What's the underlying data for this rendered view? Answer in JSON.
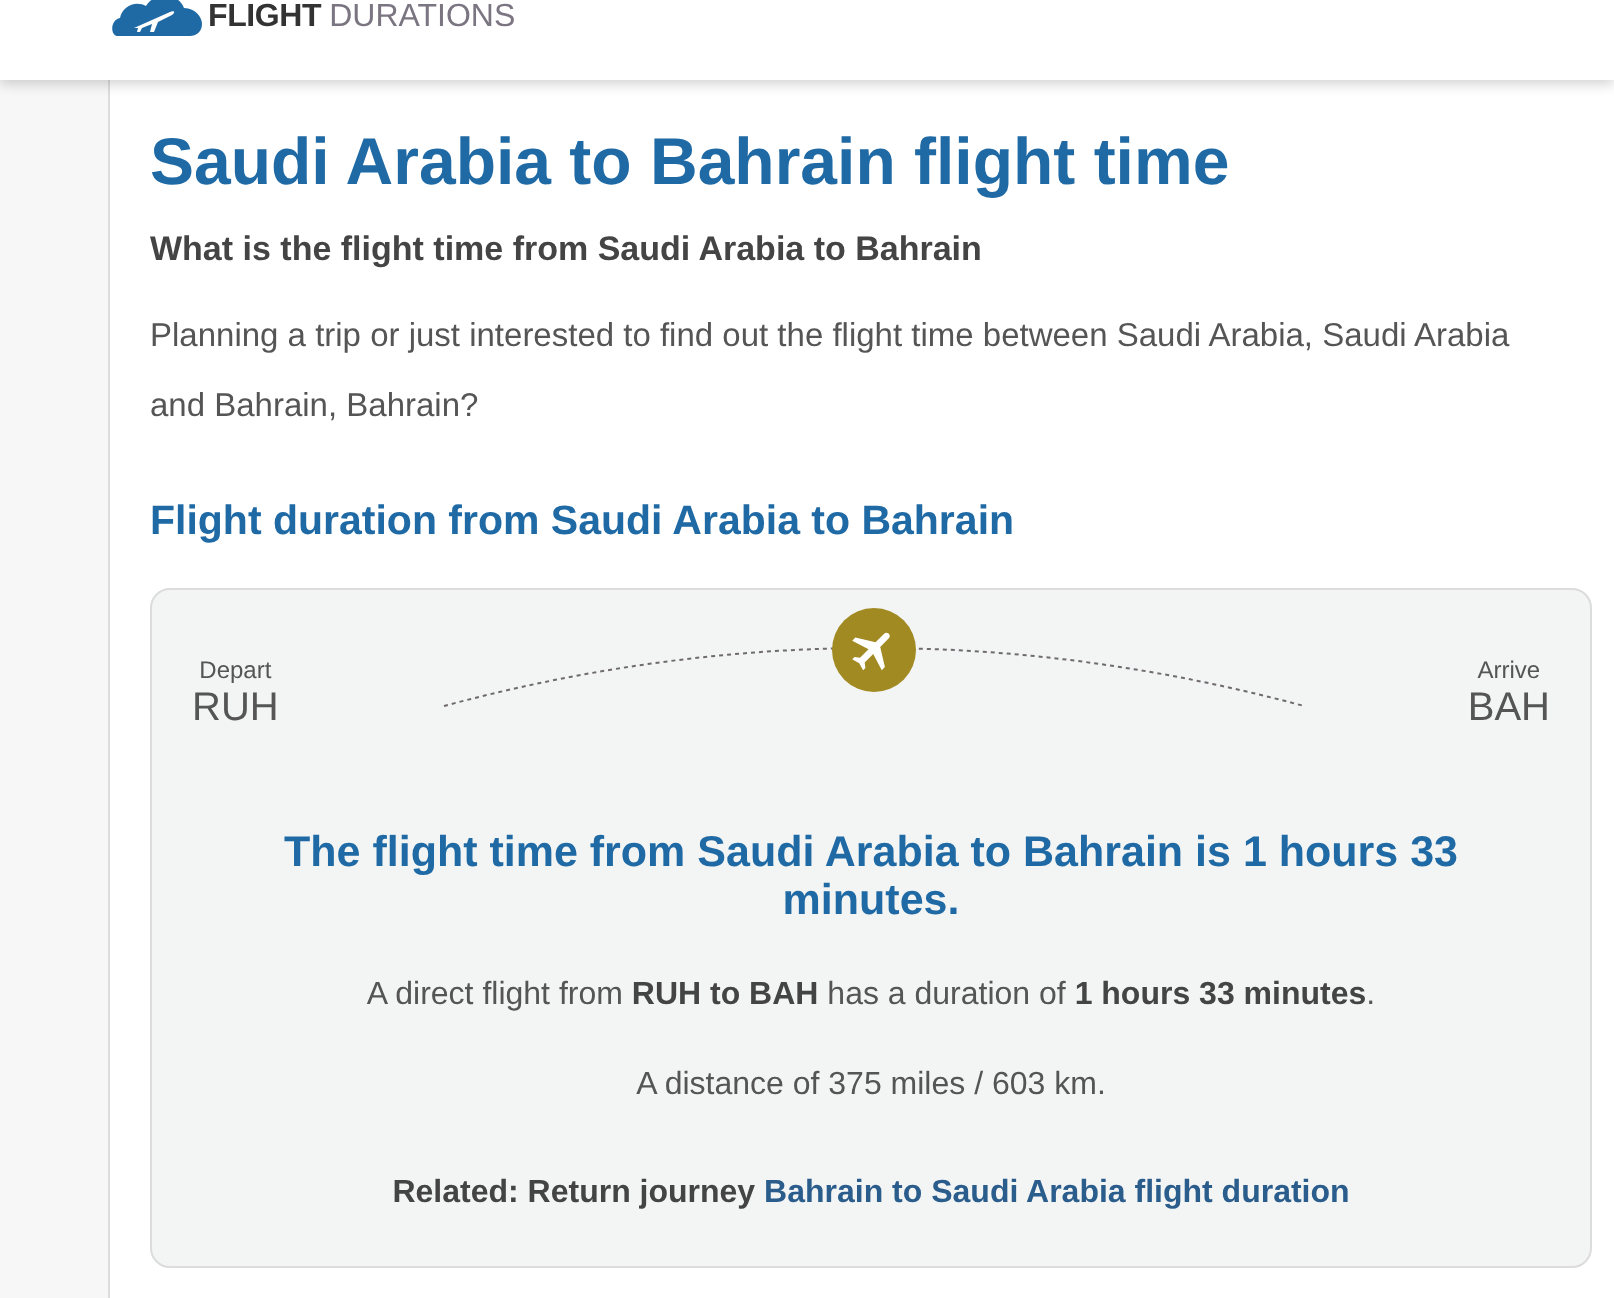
{
  "header": {
    "logo": {
      "bold": "FLIGHT",
      "light": "DURATIONS"
    }
  },
  "article": {
    "title": "Saudi Arabia to Bahrain flight time",
    "subtitle": "What is the flight time from Saudi Arabia to Bahrain",
    "intro": "Planning a trip or just interested to find out the flight time between Saudi Arabia, Saudi Arabia and Bahrain, Bahrain?",
    "section_heading": "Flight duration from Saudi Arabia to Bahrain"
  },
  "route_card": {
    "depart": {
      "label": "Depart",
      "code": "RUH"
    },
    "arrive": {
      "label": "Arrive",
      "code": "BAH"
    },
    "headline": "The flight time from Saudi Arabia to Bahrain is 1 hours 33 minutes.",
    "direct_text": "A direct flight from **RUH to BAH** has a duration of **1 hours 33 minutes**.",
    "distance": "A distance of 375 miles / 603 km.",
    "related": {
      "label": "Related: Return journey",
      "link": "Bahrain to Saudi Arabia flight duration"
    }
  }
}
